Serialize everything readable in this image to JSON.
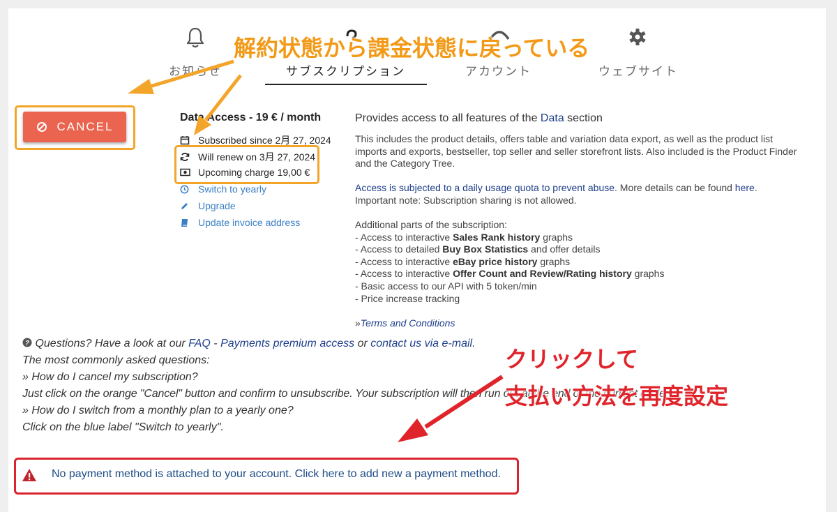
{
  "tabs": [
    {
      "label": "お知らせ",
      "icon": "bell-icon"
    },
    {
      "label": "サブスクリプション",
      "icon": "subscription-icon",
      "active": true
    },
    {
      "label": "アカウント",
      "icon": "account-icon"
    },
    {
      "label": "ウェブサイト",
      "icon": "gear-icon"
    }
  ],
  "cancel": {
    "label": "CANCEL",
    "icon": "cancel-circle-icon",
    "color": "#ea6450"
  },
  "plan": {
    "title": "Data Access - 19 € / month",
    "subscribed_since": "Subscribed since 2月 27, 2024",
    "renew": "Will renew on 3月 27, 2024",
    "upcoming_charge": "Upcoming charge 19,00 €",
    "switch_yearly": "Switch to yearly",
    "upgrade": "Upgrade",
    "update_invoice": "Update invoice address"
  },
  "description": {
    "heading_pre": "Provides access to all features of the ",
    "heading_link": "Data",
    "heading_post": " section",
    "intro": "This includes the product details, offers table and variation data export, as well as the product list imports and exports, bestseller, top seller and seller storefront lists. Also included is the Product Finder and the Category Tree.",
    "quota_link": "Access is subjected to a daily usage quota to prevent abuse",
    "quota_mid": ". More details can be found ",
    "quota_here": "here",
    "quota_end": ".",
    "important": "Important note: Subscription sharing is not allowed.",
    "additional": "Additional parts of the subscription:",
    "items": [
      {
        "pre": "- Access to interactive ",
        "bold": "Sales Rank history",
        "post": " graphs"
      },
      {
        "pre": "- Access to detailed ",
        "bold": "Buy Box Statistics",
        "post": " and offer details"
      },
      {
        "pre": "- Access to interactive ",
        "bold": "eBay price history",
        "post": " graphs"
      },
      {
        "pre": "- Access to interactive ",
        "bold": "Offer Count and Review/Rating history",
        "post": " graphs"
      },
      {
        "pre": "- Basic access to our API with 5 token/min",
        "bold": "",
        "post": ""
      },
      {
        "pre": "- Price increase tracking",
        "bold": "",
        "post": ""
      }
    ],
    "terms_prefix": "»",
    "terms": "Terms and Conditions"
  },
  "faq": {
    "q_pre": "Questions? Have a look at our ",
    "faq_link": "FAQ",
    "sep": " - ",
    "payments_link": "Payments premium access",
    "or": " or ",
    "contact_link": "contact us via e-mail",
    "end": ".",
    "common": "The most commonly asked questions:",
    "q1": "» How do I cancel my subscription?",
    "a1": "Just click on the orange \"Cancel\" button and confirm to unsubscribe. Your subscription will then run out at the end of the current cycle.",
    "q2": "» How do I switch from a monthly plan to a yearly one?",
    "a2": "Click on the blue label \"Switch to yearly\"."
  },
  "alert": {
    "text": "No payment method is attached to your account. Click here to add new a payment method.",
    "icon": "warning-triangle-icon"
  },
  "annotations": {
    "orange": "解約状態から課金状態に戻っている",
    "red_line1": "クリックして",
    "red_line2": "支払い方法を再度設定"
  },
  "colors": {
    "orange": "#f3a52a",
    "red": "#d9232d",
    "cancel": "#ea6450",
    "link": "#3a7fc4"
  }
}
